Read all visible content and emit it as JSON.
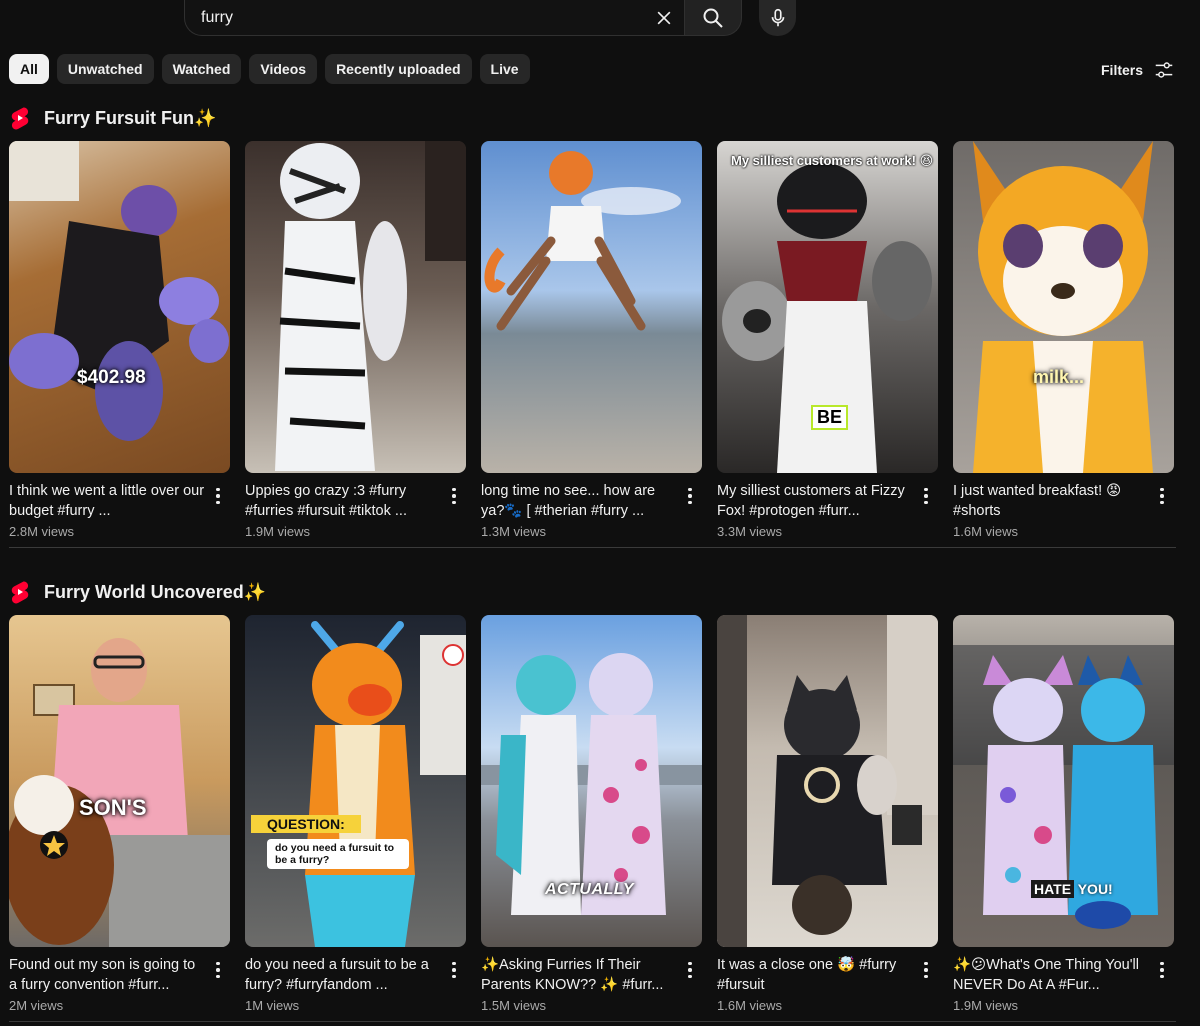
{
  "search": {
    "value": "furry"
  },
  "chips": [
    {
      "label": "All",
      "active": true
    },
    {
      "label": "Unwatched"
    },
    {
      "label": "Watched"
    },
    {
      "label": "Videos"
    },
    {
      "label": "Recently uploaded"
    },
    {
      "label": "Live"
    }
  ],
  "filters_label": "Filters",
  "colors": {
    "accent": "#ff0033",
    "background": "#0f0f0f",
    "chip": "#272727",
    "muted": "#aaaaaa"
  },
  "sections": [
    {
      "title": "Furry Fursuit Fun",
      "icon": "shorts-icon",
      "emoji": "✨",
      "items": [
        {
          "title": "I think we went a little over our budget #furry ...",
          "views": "2.8M views",
          "overlay": "$402.98"
        },
        {
          "title": "Uppies go crazy :3 #furry #furries #fursuit #tiktok ...",
          "views": "1.9M views",
          "overlay": ""
        },
        {
          "title": "long time no see... how are ya?🐾 [ #therian #furry ...",
          "views": "1.3M views",
          "overlay": ""
        },
        {
          "title": "My silliest customers at Fizzy Fox! #protogen #furr...",
          "views": "3.3M views",
          "overlay": "My silliest customers at work! 😆",
          "overlay2": "BE"
        },
        {
          "title": "I just wanted breakfast! 😡 #shorts",
          "views": "1.6M views",
          "overlay": "milk..."
        }
      ]
    },
    {
      "title": "Furry World Uncovered",
      "icon": "shorts-icon",
      "emoji": "✨",
      "items": [
        {
          "title": "Found out my son is going to a furry convention #furr...",
          "views": "2M views",
          "overlay": "SON'S"
        },
        {
          "title": "do you need a fursuit to be a furry? #furryfandom ...",
          "views": "1M views",
          "overlay": "QUESTION:",
          "overlay2": "do you need a fursuit to be a furry?"
        },
        {
          "title": "✨Asking Furries If Their Parents KNOW?? ✨ #furr...",
          "views": "1.5M views",
          "overlay": "ACTUALLY"
        },
        {
          "title": "It was a close one 🤯 #furry #fursuit",
          "views": "1.6M views",
          "overlay": ""
        },
        {
          "title": "✨😕What's One Thing You'll NEVER Do At A #Fur...",
          "views": "1.9M views",
          "overlay": "HATE",
          "overlay2": "YOU!"
        }
      ]
    }
  ]
}
